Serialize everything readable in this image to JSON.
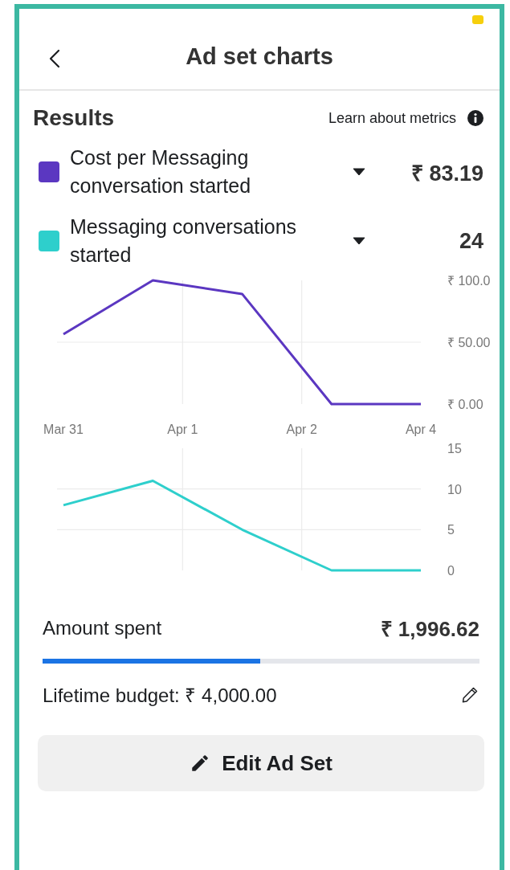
{
  "header": {
    "title": "Ad set charts"
  },
  "results": {
    "title": "Results",
    "link": "Learn about metrics",
    "metrics": [
      {
        "name": "Cost per Messaging conversation started",
        "value": "₹ 83.19",
        "color": "#5b37c1"
      },
      {
        "name": "Messaging conversations started",
        "value": "24",
        "color": "#2ecfcc"
      }
    ],
    "charts": [
      {
        "chart_data": {
          "type": "line",
          "categories": [
            "Mar 31",
            null,
            null,
            null,
            "Apr 4"
          ],
          "series": [
            {
              "color": "#5b37c1",
              "values": [
                56.5,
                100,
                89,
                0,
                0
              ]
            }
          ],
          "ylim": [
            0,
            100
          ],
          "annotations": [
            "Apr 1",
            "Apr 2"
          ],
          "yticks": [
            {
              "value": 100,
              "label": "₹ 100.0"
            },
            {
              "value": 50,
              "label": "₹ 50.00"
            },
            {
              "value": 0,
              "label": "₹ 0.00"
            }
          ]
        }
      },
      {
        "chart_data": {
          "type": "line",
          "categories": [
            null,
            null,
            null,
            null,
            null
          ],
          "series": [
            {
              "color": "#2ecfcc",
              "values": [
                8,
                11,
                5,
                0,
                0
              ]
            }
          ],
          "ylim": [
            0,
            15
          ],
          "yticks": [
            15,
            10,
            5,
            0
          ]
        }
      }
    ]
  },
  "budget": {
    "label": "Amount spent",
    "amount": "₹ 1,996.62",
    "level": 0.499,
    "lifetime": "Lifetime budget: ₹ 4,000.00"
  },
  "edit_button": "Edit Ad Set"
}
